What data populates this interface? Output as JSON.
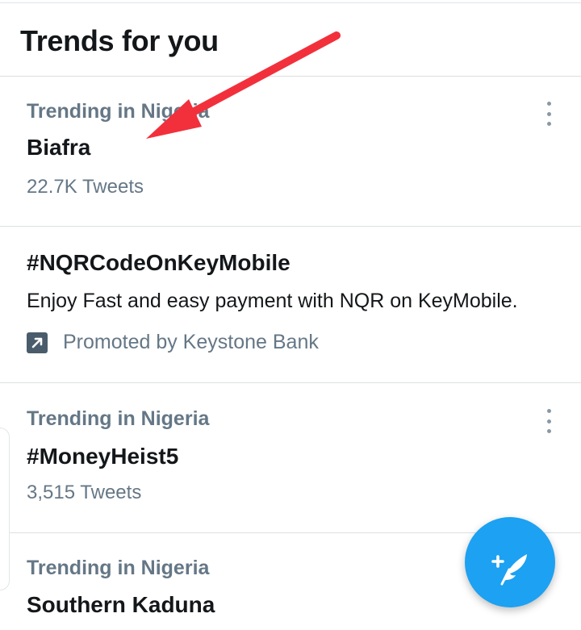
{
  "header": {
    "title": "Trends for you"
  },
  "trends": [
    {
      "context": "Trending in Nigeria",
      "name": "Biafra",
      "count": "22.7K Tweets"
    },
    {
      "context": "Trending in Nigeria",
      "name": "#MoneyHeist5",
      "count": "3,515 Tweets"
    },
    {
      "context": "Trending in Nigeria",
      "name": "Southern Kaduna"
    }
  ],
  "promoted": {
    "name": "#NQRCodeOnKeyMobile",
    "description": "Enjoy Fast and easy payment with NQR on KeyMobile.",
    "label": "Promoted by Keystone Bank",
    "icon": "promoted-arrow-icon"
  },
  "fab": {
    "icon": "compose-tweet-icon"
  },
  "colors": {
    "accent": "#1da1f2",
    "secondary_text": "#657786",
    "annotation_arrow": "#f2303c"
  }
}
